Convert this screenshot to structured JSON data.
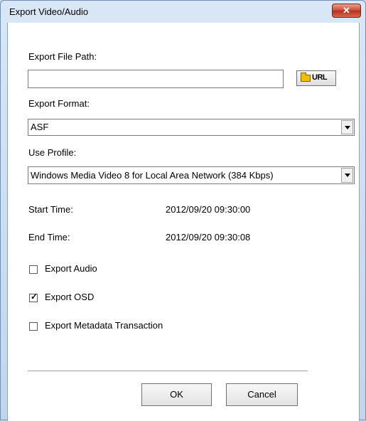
{
  "window": {
    "title": "Export Video/Audio",
    "close_glyph": "✕"
  },
  "export_path": {
    "label": "Export File Path:",
    "value": "",
    "url_button_label": "URL"
  },
  "export_format": {
    "label": "Export Format:",
    "value": "ASF"
  },
  "use_profile": {
    "label": "Use Profile:",
    "value": "Windows Media Video 8 for Local Area Network (384 Kbps)"
  },
  "start_time": {
    "label": "Start Time:",
    "value": "2012/09/20 09:30:00"
  },
  "end_time": {
    "label": "End Time:",
    "value": "2012/09/20 09:30:08"
  },
  "options": [
    {
      "label": "Export Audio",
      "checked": false
    },
    {
      "label": "Export OSD",
      "checked": true
    },
    {
      "label": "Export Metadata Transaction",
      "checked": false
    }
  ],
  "buttons": {
    "ok": "OK",
    "cancel": "Cancel"
  },
  "check_glyph": "✓",
  "icons": {
    "close": "close-icon",
    "folder": "folder-open-icon",
    "dropdown": "chevron-down-icon"
  }
}
